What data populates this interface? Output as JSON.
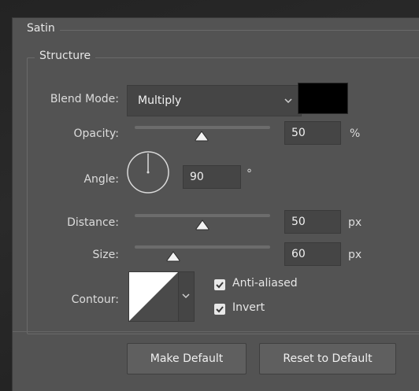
{
  "panel": {
    "title": "Satin"
  },
  "structure": {
    "title": "Structure"
  },
  "blend_mode": {
    "label": "Blend Mode:",
    "value": "Multiply",
    "swatch_color": "#000000"
  },
  "opacity": {
    "label": "Opacity:",
    "value": "50",
    "unit": "%",
    "level": 0.5
  },
  "angle": {
    "label": "Angle:",
    "value": "90",
    "unit": "°"
  },
  "distance": {
    "label": "Distance:",
    "value": "50",
    "unit": "px",
    "level": 0.5
  },
  "size": {
    "label": "Size:",
    "value": "60",
    "unit": "px",
    "level": 0.3
  },
  "contour": {
    "label": "Contour:",
    "options": [
      {
        "label": "Anti-aliased",
        "checked": true
      },
      {
        "label": "Invert",
        "checked": true
      }
    ]
  },
  "buttons": {
    "make_default": "Make Default",
    "reset_default": "Reset to Default"
  },
  "colors": {
    "panel_bg": "#535353",
    "field_bg": "#454545",
    "accent_text": "#e6e6e6"
  }
}
